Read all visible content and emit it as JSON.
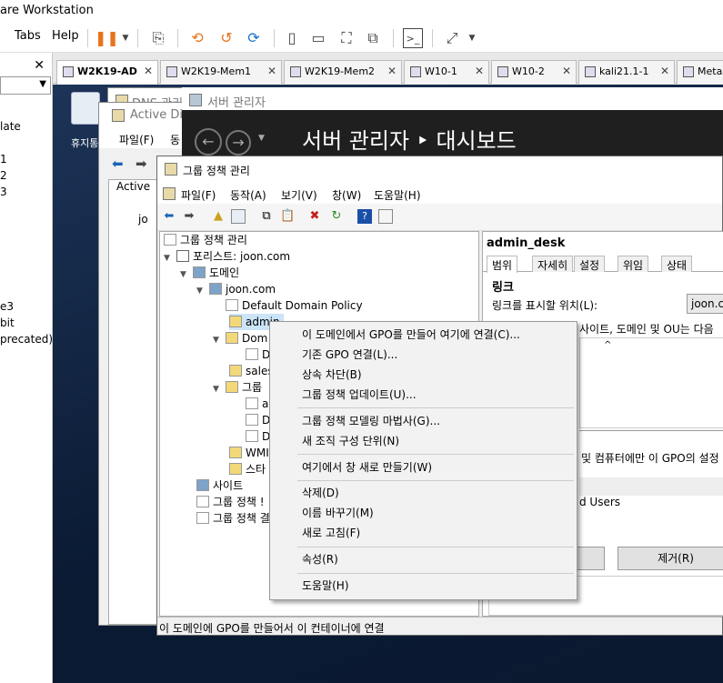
{
  "vmware": {
    "title": "are Workstation",
    "menu": {
      "tabs": "Tabs",
      "help": "Help"
    },
    "library": {
      "items": [
        "late",
        "1",
        "2",
        "3",
        "e3",
        "bit",
        "precated)"
      ]
    },
    "tabs": [
      {
        "label": "W2K19-AD",
        "active": true
      },
      {
        "label": "W2K19-Mem1",
        "active": false
      },
      {
        "label": "W2K19-Mem2",
        "active": false
      },
      {
        "label": "W10-1",
        "active": false
      },
      {
        "label": "W10-2",
        "active": false
      },
      {
        "label": "kali21.1-1",
        "active": false
      },
      {
        "label": "Metas",
        "active": false
      }
    ]
  },
  "guest": {
    "recycle_bin": "휴지통",
    "dns_title": "DNS 관리",
    "ad_title": "Active Dire",
    "ad_menu": {
      "file": "파일(F)",
      "action": "동"
    },
    "ad_tree": {
      "root": "Active",
      "dom": "jo"
    },
    "server_manager": {
      "title": "서버 관리자",
      "breadcrumb": "서버 관리자 ‣ 대시보드"
    },
    "gpm": {
      "title": "그룹 정책 관리",
      "menu": [
        "파일(F)",
        "동작(A)",
        "보기(V)",
        "창(W)",
        "도움말(H)"
      ],
      "tree": {
        "root": "그룹 정책 관리",
        "forest": "포리스트: joon.com",
        "domains": "도메인",
        "domain": "joon.com",
        "ddp": "Default Domain Policy",
        "admin": "admin",
        "dom_ctrl": "Dom",
        "dom_ctrl_child": "D",
        "sales": "sales",
        "group": "그룹",
        "group_c1": "a",
        "group_c2": "D",
        "group_c3": "D",
        "wmi": "WMI",
        "starter": "스타",
        "sites": "사이트",
        "modeling": "그룹 정책 !",
        "results": "그룹 정책 결"
      },
      "right": {
        "header": "admin_desk",
        "tabs": [
          "범위",
          "자세히",
          "설정",
          "위임",
          "상태"
        ],
        "section": "링크",
        "link_label": "링크를 표시할 위치(L):",
        "link_value": "joon.co",
        "desc": "사이트, 도메인 및 OU는 다음",
        "filter_desc": "및 컴퓨터에만 이 GPO의 설정",
        "auth_users": "d Users",
        "remove_button": "제거(R)"
      },
      "status": "이 도메인에 GPO를 만들어서 이 컨테이너에 연결"
    },
    "context_menu": [
      "이 도메인에서 GPO를 만들어 여기에 연결(C)...",
      "기존 GPO 연결(L)...",
      "상속 차단(B)",
      "그룹 정책 업데이트(U)...",
      "그룹 정책 모델링 마법사(G)...",
      "새 조직 구성 단위(N)",
      "여기에서 창 새로 만들기(W)",
      "삭제(D)",
      "이름 바꾸기(M)",
      "새로 고침(F)",
      "속성(R)",
      "도움말(H)"
    ]
  }
}
